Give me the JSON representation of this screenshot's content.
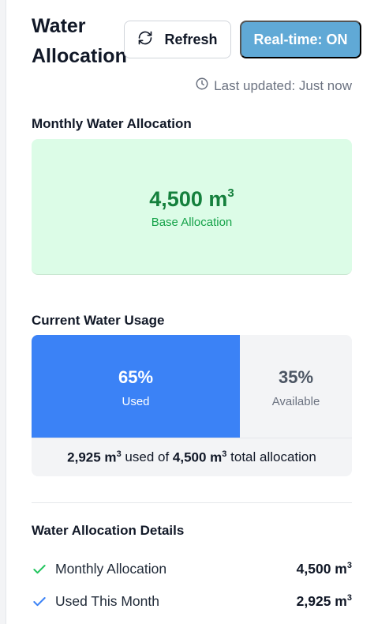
{
  "header": {
    "title": "Water Allocation",
    "refresh_label": "Refresh",
    "realtime_label": "Real-time: ON"
  },
  "status": {
    "last_updated": "Last updated: Just now"
  },
  "monthly_allocation": {
    "section_title": "Monthly Water Allocation",
    "value": "4,500 m",
    "unit_superscript": "3",
    "label": "Base Allocation"
  },
  "usage": {
    "section_title": "Current Water Usage",
    "used_percent": "65%",
    "used_label": "Used",
    "available_percent": "35%",
    "available_label": "Available",
    "used_fraction": 0.65,
    "summary_used": "2,925 m",
    "summary_mid": " used of ",
    "summary_total": "4,500 m",
    "summary_end": " total allocation",
    "sup": "3"
  },
  "details": {
    "section_title": "Water Allocation Details",
    "rows": [
      {
        "label": "Monthly Allocation",
        "value": "4,500 m",
        "sup": "3",
        "icon": "check-icon",
        "icon_color": "#22c55e"
      },
      {
        "label": "Used This Month",
        "value": "2,925 m",
        "sup": "3",
        "icon": "check-icon",
        "icon_color": "#3b82f6"
      }
    ]
  },
  "colors": {
    "accent_blue": "#3b82f6",
    "realtime_button": "#60a9d6",
    "allocation_bg": "#dcfce7",
    "allocation_text": "#15803d"
  }
}
